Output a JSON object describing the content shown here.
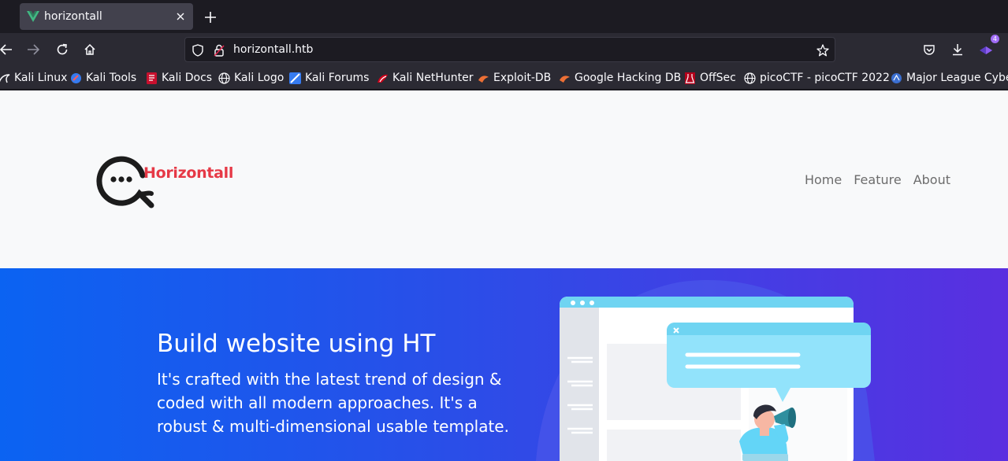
{
  "browser": {
    "tab": {
      "title": "horizontall"
    },
    "url": "horizontall.htb",
    "downloads_badge": "4",
    "bookmarks": [
      {
        "label": "Kali Linux",
        "icon": "kali-dragon-icon"
      },
      {
        "label": "Kali Tools",
        "icon": "kali-tools-icon"
      },
      {
        "label": "Kali Docs",
        "icon": "kali-docs-icon"
      },
      {
        "label": "Kali Logo",
        "icon": "globe-icon"
      },
      {
        "label": "Kali Forums",
        "icon": "kali-forums-icon"
      },
      {
        "label": "Kali NetHunter",
        "icon": "nethunter-icon"
      },
      {
        "label": "Exploit-DB",
        "icon": "exploit-db-icon"
      },
      {
        "label": "Google Hacking DB",
        "icon": "ghdb-icon"
      },
      {
        "label": "OffSec",
        "icon": "offsec-icon"
      },
      {
        "label": "picoCTF - picoCTF 2022",
        "icon": "globe-icon"
      },
      {
        "label": "Major League Cyber",
        "icon": "mlc-icon"
      }
    ]
  },
  "site": {
    "logo_text": "Horizontall",
    "nav": [
      "Home",
      "Feature",
      "About"
    ],
    "hero": {
      "title": "Build website using HT",
      "description": "It's crafted with the latest trend of design & coded with all modern approaches. It's a robust & multi-dimensional usable template."
    }
  },
  "colors": {
    "brand_red": "#e63946",
    "hero_gradient_start": "#0b63f2",
    "hero_gradient_end": "#5a2fe0",
    "browser_chrome": "#2b2a33"
  }
}
